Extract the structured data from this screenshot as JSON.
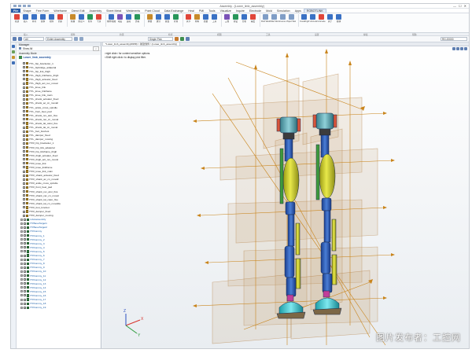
{
  "window": {
    "title": "Assembly - [Lower_limb_assembly]",
    "close": "✕",
    "minimize": "—",
    "maximize": "☐"
  },
  "menu": [
    "File",
    "Shape",
    "Free Form",
    "Wireframe",
    "Direct Edit",
    "Assembly",
    "Sheet Metal",
    "Weldments",
    "Point Cloud",
    "Data Exchange",
    "Heal",
    "PMI",
    "Tools",
    "Visualize",
    "Inquire",
    "Electrode",
    "Mold",
    "Simulation",
    "Apps",
    "ROBOTLINK"
  ],
  "ribbon": [
    {
      "label": "新建",
      "color": "#e0463a"
    },
    {
      "label": "插入",
      "color": "#3a71c4"
    },
    {
      "label": "阵列",
      "color": "#3a71c4"
    },
    {
      "label": "替换",
      "color": "#3a71c4"
    },
    {
      "label": "组件",
      "color": "#3a71c4"
    },
    {
      "label": "约束",
      "color": "#e0463a"
    },
    {
      "label": "机械",
      "color": "#c78a2a"
    },
    {
      "label": "重定义",
      "color": "#3a71c4"
    },
    {
      "label": "检查",
      "color": "#28965a"
    },
    {
      "label": "干涉",
      "color": "#e0463a"
    },
    {
      "label": "爆炸视图",
      "color": "#3a71c4"
    },
    {
      "label": "动画",
      "color": "#7a52b8"
    },
    {
      "label": "运动",
      "color": "#3a71c4"
    },
    {
      "label": "仿真",
      "color": "#28965a"
    },
    {
      "label": "参数",
      "color": "#c78a2a"
    },
    {
      "label": "统计",
      "color": "#3a71c4"
    },
    {
      "label": "属性",
      "color": "#3a71c4"
    },
    {
      "label": "查询",
      "color": "#28965a"
    },
    {
      "label": "关节",
      "color": "#e0463a"
    },
    {
      "label": "材料",
      "color": "#c78a2a"
    },
    {
      "label": "质量",
      "color": "#3a71c4"
    },
    {
      "label": "工具",
      "color": "#3a71c4"
    },
    {
      "label": "三维",
      "color": "#7a52b8"
    },
    {
      "label": "验证",
      "color": "#28965a"
    },
    {
      "label": "分析",
      "color": "#3a71c4"
    },
    {
      "label": "输出",
      "color": "#e0463a"
    },
    {
      "label": "Roll Weld",
      "color": "#7f9dc6"
    },
    {
      "label": "Fillet Weld",
      "color": "#7f9dc6"
    },
    {
      "label": "Groove Weld",
      "color": "#7f9dc6"
    },
    {
      "label": "Spot Weld",
      "color": "#7f9dc6"
    },
    {
      "label": "Coralhigine",
      "color": "#3a71c4"
    },
    {
      "label": "Ⅰ Unicode",
      "color": "#3a71c4"
    },
    {
      "label": "Unicode",
      "color": "#e0463a"
    },
    {
      "label": "关于",
      "color": "#3a71c4"
    },
    {
      "label": "模块",
      "color": "#3a71c4"
    }
  ],
  "groups": [
    "插入",
    "组件",
    "约束",
    "检查",
    "视图",
    "工具",
    "设置",
    "焊接",
    "帮助"
  ],
  "filterbar": {
    "combo1": "All",
    "combo2": "Entire Assembly",
    "combo3": "Single Pick",
    "combo4": "RG.20000"
  },
  "panel": {
    "title": "Manager",
    "show_all": "Show All",
    "mode": "Assembly Mode",
    "root": "Lower_limb_assembly",
    "tree": [
      {
        "n": "HYL_hip_bracketier_1",
        "t": "part"
      },
      {
        "n": "HYL_hipbridge_adaterial",
        "t": "part"
      },
      {
        "n": "HYL_hip_link_thigh",
        "t": "part"
      },
      {
        "n": "HYL_thigh_linkframe_thigh",
        "t": "part"
      },
      {
        "n": "HYL_thigh_actuator_fixed",
        "t": "part"
      },
      {
        "n": "HYL_thigh_act_rev_moval",
        "t": "part"
      },
      {
        "n": "HYL_knee_link",
        "t": "part"
      },
      {
        "n": "HYL_knee_linkframe",
        "t": "part"
      },
      {
        "n": "HYL_knee_link_main",
        "t": "part"
      },
      {
        "n": "HYL_shank_actuator_fixed",
        "t": "part"
      },
      {
        "n": "HYL_shank_ac_cn_movall",
        "t": "part"
      },
      {
        "n": "HYL_ankle_cross_spindle",
        "t": "part"
      },
      {
        "n": "HYL_front_heel_pad",
        "t": "part"
      },
      {
        "n": "HYL_shank_rev_ator_fixa",
        "t": "part"
      },
      {
        "n": "HYL_shank_rac_cn_moval",
        "t": "part"
      },
      {
        "n": "HYL_shank_lat_cator_fixe",
        "t": "part"
      },
      {
        "n": "HYL_shank_lat_cn_moval",
        "t": "part"
      },
      {
        "n": "HYL_foot_forefoot",
        "t": "part"
      },
      {
        "n": "HYL_damper_fixed",
        "t": "part"
      },
      {
        "n": "HYL_damper_moving",
        "t": "part"
      },
      {
        "n": "HYR_hip_bracketier_1",
        "t": "part"
      },
      {
        "n": "HYR_hip_link_adaterial",
        "t": "part"
      },
      {
        "n": "HYR_hip_linkframe_thigh",
        "t": "part"
      },
      {
        "n": "HYR_thigh_actuator_fixed",
        "t": "part"
      },
      {
        "n": "HYR_thigh_act_rev_moval",
        "t": "part"
      },
      {
        "n": "HYR_knee_link",
        "t": "part"
      },
      {
        "n": "HYR_knee_linkframe",
        "t": "part"
      },
      {
        "n": "HYR_knee_link_main",
        "t": "part"
      },
      {
        "n": "HYR_shank_actuator_fixed",
        "t": "part"
      },
      {
        "n": "HYR_shank_ac_cn_movall",
        "t": "part"
      },
      {
        "n": "HYR_ankle_cross_spindle",
        "t": "part"
      },
      {
        "n": "HYR_front_heel_pad",
        "t": "part"
      },
      {
        "n": "HYR_shank_rev_ator_fixa",
        "t": "part"
      },
      {
        "n": "HYR_shank_rac_cn_moval",
        "t": "part"
      },
      {
        "n": "HYR_shank_lat_cator_fixe",
        "t": "part"
      },
      {
        "n": "HYR_shank_lat_cn_movable",
        "t": "part"
      },
      {
        "n": "HYR_foot_forefoot",
        "t": "part"
      },
      {
        "n": "HYR_damper_fixed",
        "t": "part"
      },
      {
        "n": "HYR_damper_moving",
        "t": "part"
      },
      {
        "n": "robotassembly",
        "t": "asm"
      },
      {
        "n": "HYBaseTarget1",
        "t": "asm"
      },
      {
        "n": "HYBaseTarget2",
        "t": "asm"
      },
      {
        "n": "HYDummy",
        "t": "asm"
      },
      {
        "n": "HYDummy_1",
        "t": "asm"
      },
      {
        "n": "HYDummy_2",
        "t": "asm"
      },
      {
        "n": "HYDummy_3",
        "t": "asm"
      },
      {
        "n": "HYDummy_4",
        "t": "asm"
      },
      {
        "n": "HYDummy_5",
        "t": "asm"
      },
      {
        "n": "HYDummy_6",
        "t": "asm"
      },
      {
        "n": "HYDummy_7",
        "t": "asm"
      },
      {
        "n": "HYDummy_8",
        "t": "asm"
      },
      {
        "n": "HYDummy_9",
        "t": "asm"
      },
      {
        "n": "HYDummy_10",
        "t": "asm"
      },
      {
        "n": "HYDummy_11",
        "t": "asm"
      },
      {
        "n": "HYDummy_12",
        "t": "asm"
      },
      {
        "n": "HYDummy_13",
        "t": "asm"
      },
      {
        "n": "HYDummy_14",
        "t": "asm"
      },
      {
        "n": "HYDummy_15",
        "t": "asm"
      },
      {
        "n": "HYDummy_16",
        "t": "asm"
      },
      {
        "n": "HYDummy_17",
        "t": "asm"
      },
      {
        "n": "HYDummy_18",
        "t": "asm"
      },
      {
        "n": "HYDummy_19",
        "t": "asm"
      }
    ]
  },
  "viewport": {
    "tab": "*Lower_limb_assembly(W258) > 新建零件 > [Lower_limb_assembly]",
    "hint1": ">right click< for context sensitive options.",
    "hint2": "<Shift right click> to display pick filter.",
    "axis_x": "X",
    "axis_y": "Y",
    "axis_z": "Z"
  },
  "watermark": "图片发布者：工控网"
}
